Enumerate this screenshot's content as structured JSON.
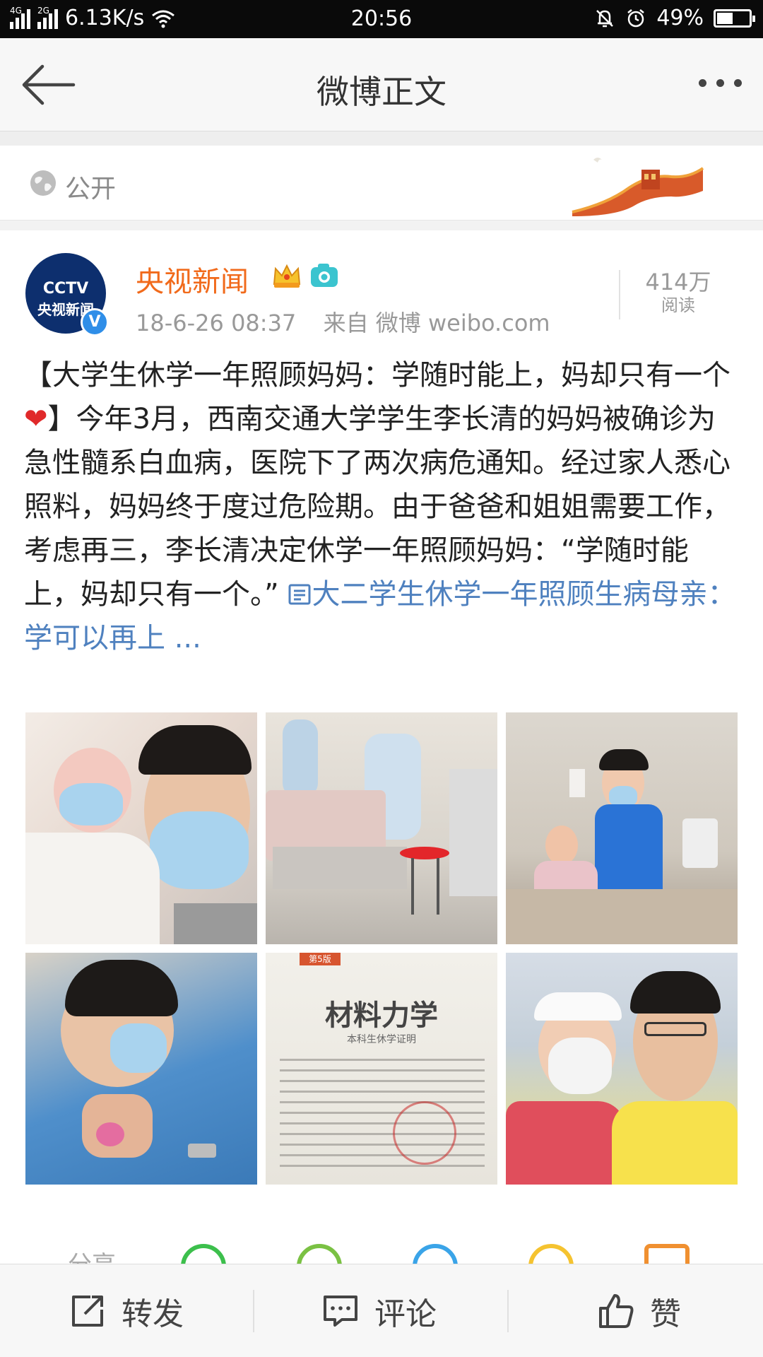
{
  "status_bar": {
    "net1": "4G",
    "net2": "2G",
    "speed": "6.13K/s",
    "time": "20:56",
    "battery_text": "49%",
    "battery_level": 0.49
  },
  "nav": {
    "title": "微博正文"
  },
  "visibility": {
    "label": "公开"
  },
  "post": {
    "avatar_top": "CCTV",
    "avatar_bottom": "央视新闻",
    "verified_mark": "V",
    "username": "央视新闻",
    "time": "18-6-26 08:37",
    "source": "来自 微博 weibo.com",
    "reads_count": "414万",
    "reads_label": "阅读",
    "text_part1": "【大学生休学一年照顾妈妈：学随时能上，妈却只有一个",
    "text_heart": "❤",
    "text_part2": "】今年3月，西南交通大学学生李长清的妈妈被确诊为急性髓系白血病，医院下了两次病危通知。经过家人悉心照料，妈妈终于度过危险期。由于爸爸和姐姐需要工作，考虑再三，李长清决定休学一年照顾妈妈：“学随时能上，妈却只有一个。”",
    "link_text": "大二学生休学一年照顾生病母亲：学可以再上 ...",
    "doc_badge": "第5版",
    "doc_title": "材料力学",
    "doc_subtitle": "本科生休学证明"
  },
  "share": {
    "label": "分享"
  },
  "actions": {
    "repost": "转发",
    "comment": "评论",
    "like": "赞"
  },
  "colors": {
    "username": "#f16a1b",
    "link": "#4f81bf",
    "verified": "#2f8ee8"
  }
}
